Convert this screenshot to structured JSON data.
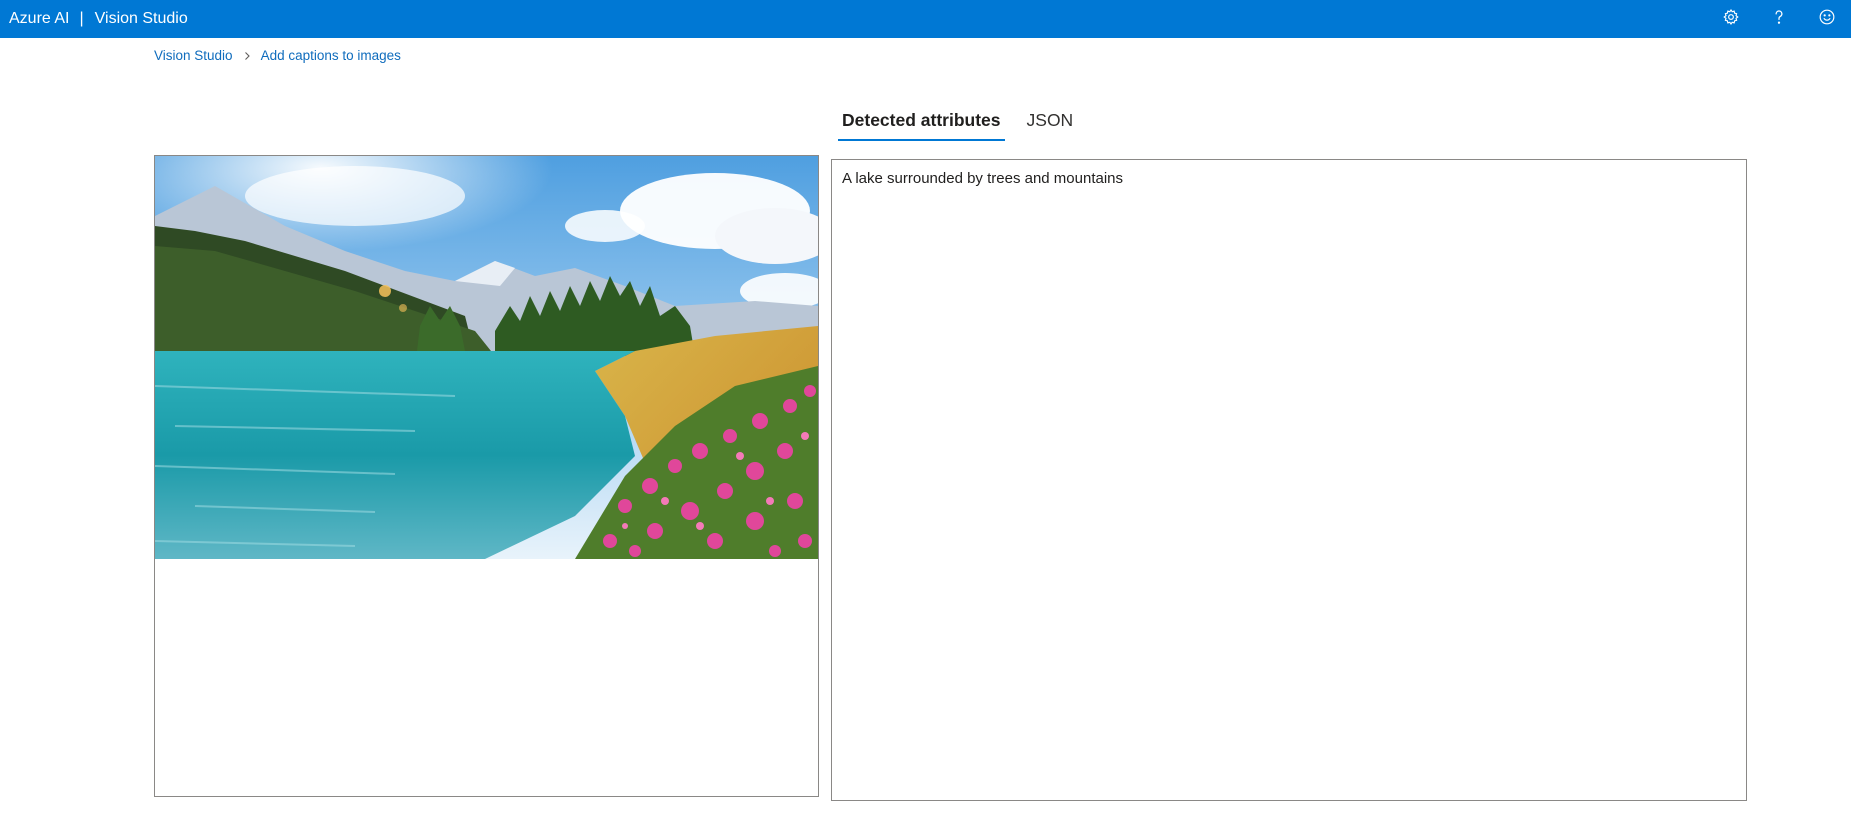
{
  "header": {
    "brand_left": "Azure AI",
    "brand_separator": "|",
    "brand_right": "Vision Studio",
    "background_color": "#0078d4",
    "icons": [
      "gear-icon",
      "help-icon",
      "feedback-smiley-icon"
    ]
  },
  "breadcrumb": {
    "items": [
      {
        "label": "Vision Studio"
      },
      {
        "label": "Add captions to images"
      }
    ]
  },
  "tabs": [
    {
      "label": "Detected attributes",
      "active": true
    },
    {
      "label": "JSON",
      "active": false
    }
  ],
  "results": {
    "caption": "A lake surrounded by trees and mountains"
  },
  "colors": {
    "accent": "#0078d4",
    "link": "#0f6cbd"
  }
}
